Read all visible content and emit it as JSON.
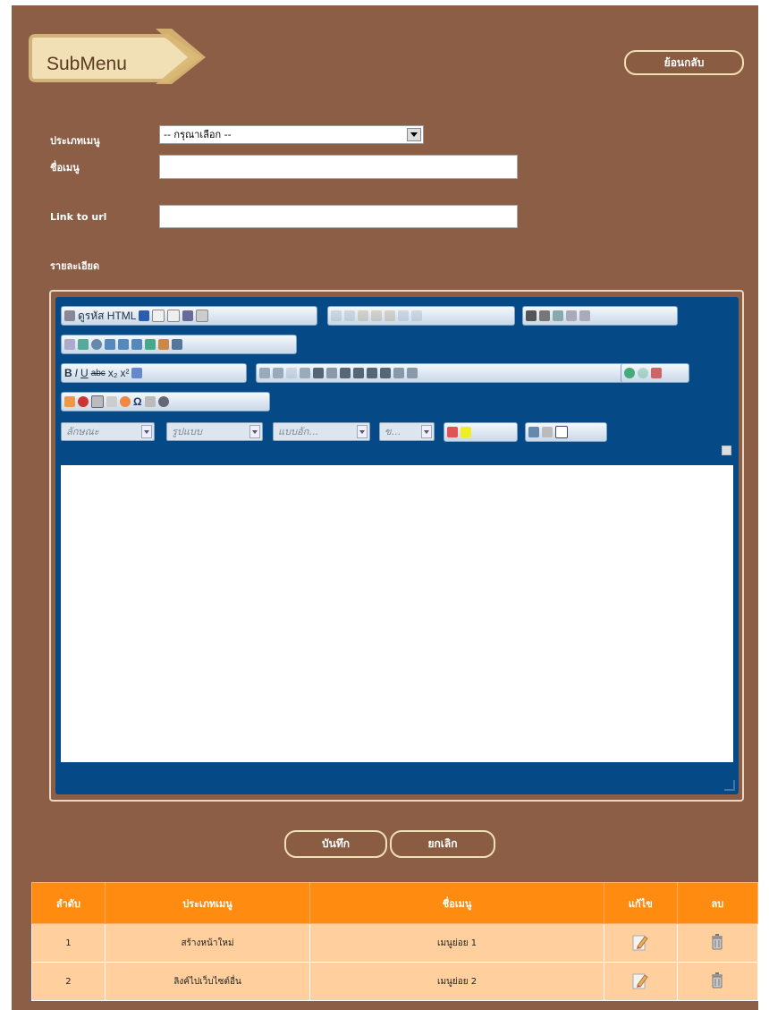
{
  "header": {
    "banner_label": "SubMenu",
    "back_button": "ย้อนกลับ"
  },
  "form": {
    "menu_type_label": "ประเภทเมนู",
    "menu_type_value": "-- กรุณาเลือก --",
    "menu_name_label": "ชื่อเมนู",
    "menu_name_value": "",
    "link_label": "Link to url",
    "link_value": "",
    "detail_label": "รายละเอียด"
  },
  "editor": {
    "source_button": "ดูรหัส HTML",
    "combos": [
      "ลักษณะ",
      "รูปแบบ",
      "แบบอัก...",
      "ข..."
    ]
  },
  "actions": {
    "save": "บันทึก",
    "cancel": "ยกเลิก"
  },
  "table": {
    "headers": [
      "ลำดับ",
      "ประเภทเมนู",
      "ชื่อเมนู",
      "แก้ไข",
      "ลบ"
    ],
    "rows": [
      {
        "no": "1",
        "type": "สร้างหน้าใหม่",
        "name": "เมนูย่อย 1"
      },
      {
        "no": "2",
        "type": "ลิงค์ไปเว็บไซต์อื่น",
        "name": "เมนูย่อย 2"
      }
    ]
  },
  "colors": {
    "panel_bg": "#8b5e45",
    "editor_bg": "#054a86",
    "table_header": "#ff8b10",
    "table_row": "#ffd09e"
  }
}
